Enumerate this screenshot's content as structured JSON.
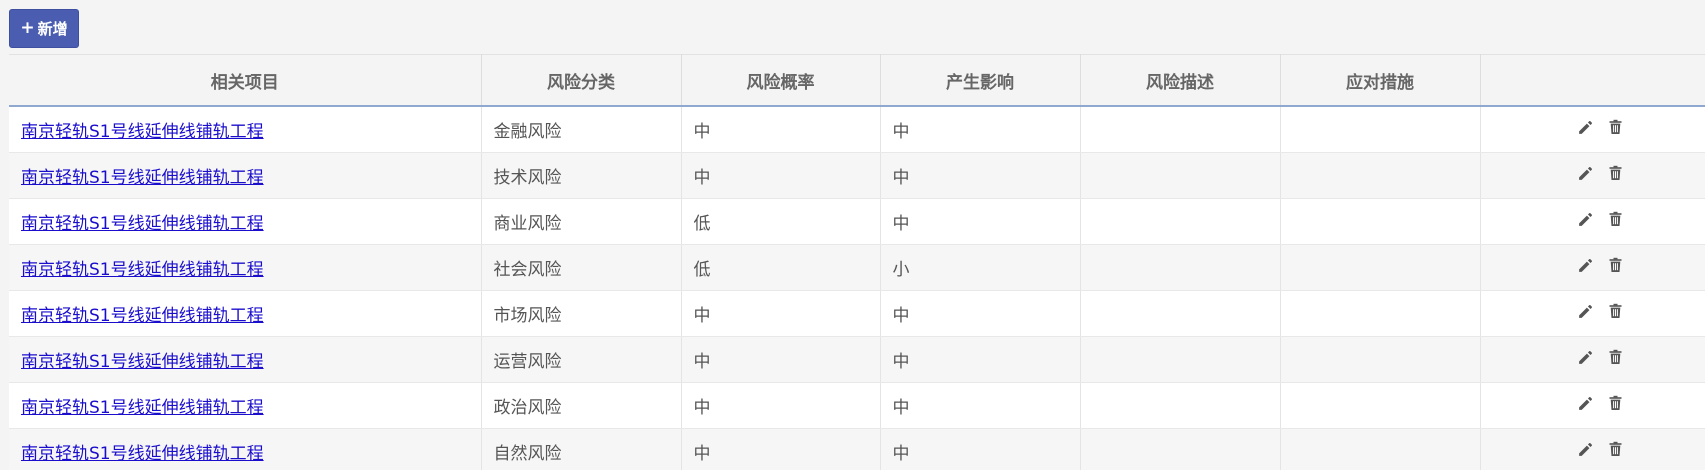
{
  "toolbar": {
    "add_label": "新增"
  },
  "table": {
    "headers": [
      "相关项目",
      "风险分类",
      "风险概率",
      "产生影响",
      "风险描述",
      "应对措施",
      ""
    ],
    "rows": [
      {
        "project": "南京轻轨S1号线延伸线铺轨工程",
        "category": "金融风险",
        "probability": "中",
        "impact": "中",
        "description": "",
        "measures": ""
      },
      {
        "project": "南京轻轨S1号线延伸线铺轨工程",
        "category": "技术风险",
        "probability": "中",
        "impact": "中",
        "description": "",
        "measures": ""
      },
      {
        "project": "南京轻轨S1号线延伸线铺轨工程",
        "category": "商业风险",
        "probability": "低",
        "impact": "中",
        "description": "",
        "measures": ""
      },
      {
        "project": "南京轻轨S1号线延伸线铺轨工程",
        "category": "社会风险",
        "probability": "低",
        "impact": "小",
        "description": "",
        "measures": ""
      },
      {
        "project": "南京轻轨S1号线延伸线铺轨工程",
        "category": "市场风险",
        "probability": "中",
        "impact": "中",
        "description": "",
        "measures": ""
      },
      {
        "project": "南京轻轨S1号线延伸线铺轨工程",
        "category": "运营风险",
        "probability": "中",
        "impact": "中",
        "description": "",
        "measures": ""
      },
      {
        "project": "南京轻轨S1号线延伸线铺轨工程",
        "category": "政治风险",
        "probability": "中",
        "impact": "中",
        "description": "",
        "measures": ""
      },
      {
        "project": "南京轻轨S1号线延伸线铺轨工程",
        "category": "自然风险",
        "probability": "中",
        "impact": "中",
        "description": "",
        "measures": ""
      }
    ]
  },
  "icons": {
    "plus": "plus-icon",
    "edit": "pencil-icon",
    "delete": "trash-icon"
  },
  "colors": {
    "button": "#4a5db1",
    "link": "#1a0dcc",
    "header_border": "#8fa8cf",
    "icon": "#555555"
  }
}
